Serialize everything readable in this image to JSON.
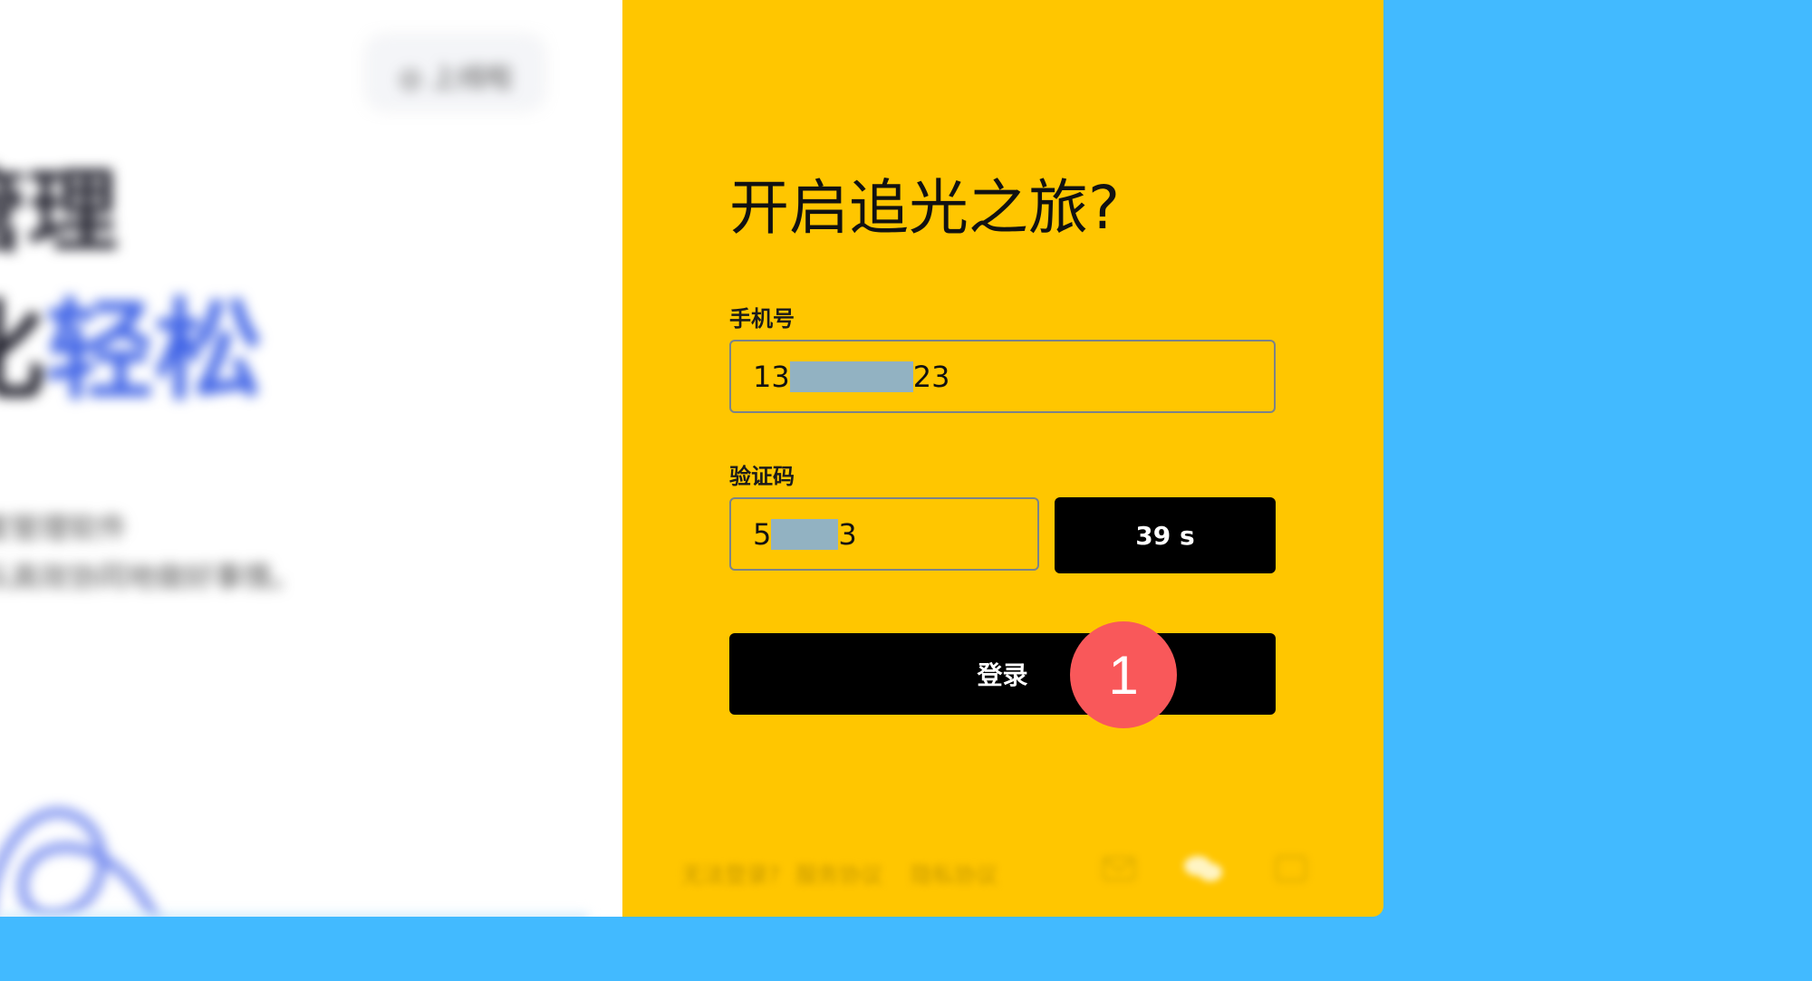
{
  "left_panel": {
    "badge_text": "◎ 上线啦",
    "headline_line1": "管理",
    "headline_line2_plain": "化",
    "headline_line2_accent": "轻松",
    "subtext_line1": "套管理软件",
    "subtext_line2": "队高效协同地做好事情。",
    "colors": {
      "accent": "#3f63e6"
    }
  },
  "login_form": {
    "title": "开启追光之旅?",
    "phone_label": "手机号",
    "phone_prefix": "13",
    "phone_suffix": "23",
    "code_label": "验证码",
    "code_prefix": "5",
    "code_suffix": "3",
    "countdown_label": "39 s",
    "login_label": "登录",
    "colors": {
      "card_background": "#ffc600",
      "button_background": "#000000",
      "mask": "#92b2c2"
    }
  },
  "footer": {
    "links": [
      "无法登录?",
      "服务协议",
      "隐私协议"
    ],
    "icons": [
      "mail-icon",
      "wechat-icon",
      "app-icon"
    ]
  },
  "annotation": {
    "step_number": "1",
    "color": "#f9585a"
  },
  "page": {
    "background_color": "#42baff"
  }
}
